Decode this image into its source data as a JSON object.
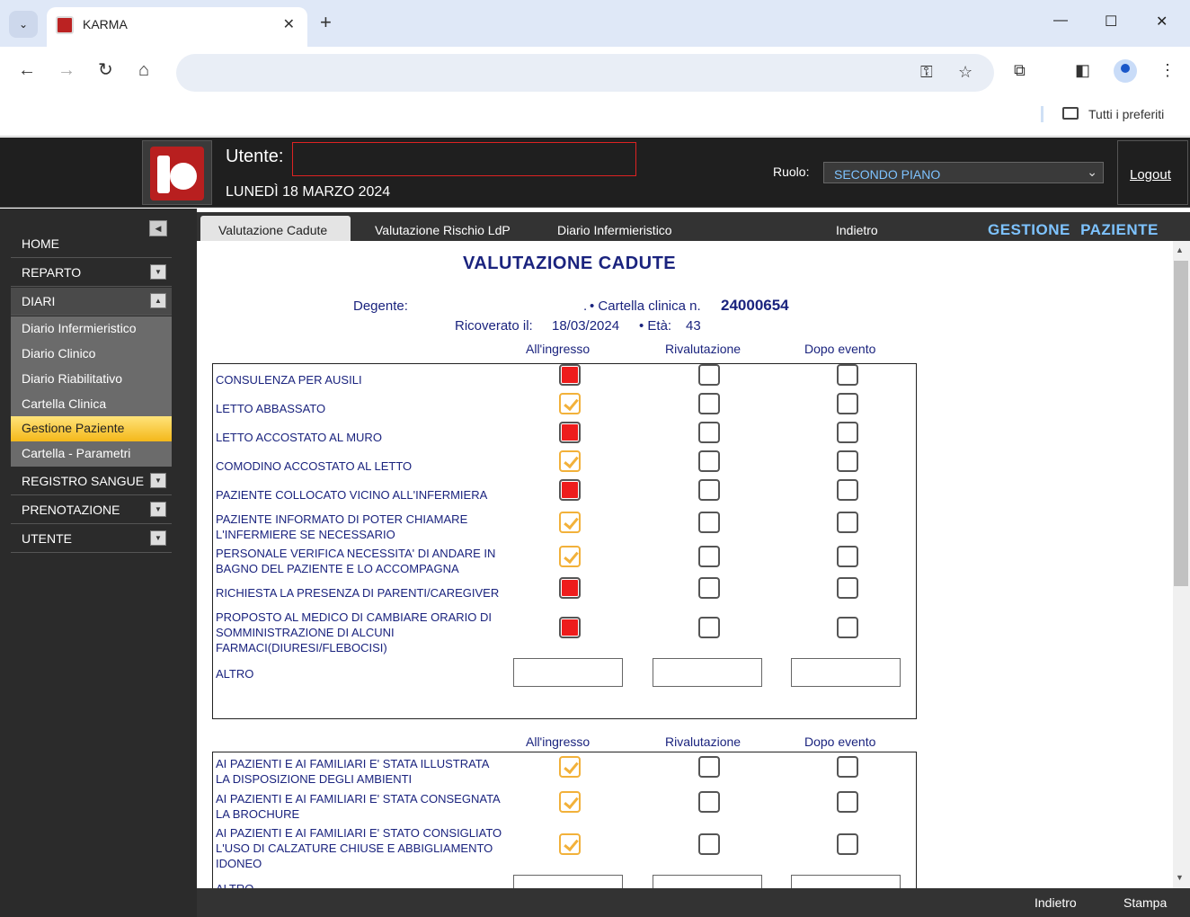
{
  "browser": {
    "tab_title": "KARMA",
    "bookmarks_label": "Tutti i preferiti"
  },
  "header": {
    "user_label": "Utente:",
    "user_value": "",
    "date": "LUNEDÌ 18 MARZO 2024",
    "role_label": "Ruolo:",
    "role_value": "SECONDO PIANO",
    "logout": "Logout"
  },
  "sidebar": {
    "items": [
      {
        "label": "HOME"
      },
      {
        "label": "REPARTO"
      },
      {
        "label": "DIARI"
      },
      {
        "label": "REGISTRO SANGUE"
      },
      {
        "label": "PRENOTAZIONE"
      },
      {
        "label": "UTENTE"
      }
    ],
    "sub_items": [
      {
        "label": "Diario Infermieristico"
      },
      {
        "label": "Diario Clinico"
      },
      {
        "label": "Diario Riabilitativo"
      },
      {
        "label": "Cartella Clinica"
      },
      {
        "label": "Gestione Paziente"
      },
      {
        "label": "Cartella - Parametri"
      }
    ]
  },
  "tabs": [
    {
      "label": "Valutazione Cadute"
    },
    {
      "label": "Valutazione Rischio LdP"
    },
    {
      "label": "Diario Infermieristico"
    },
    {
      "label": "Indietro"
    }
  ],
  "page_heading": "GESTIONE  PAZIENTE",
  "form": {
    "title": "VALUTAZIONE CADUTE",
    "degente_label": "Degente:",
    "degente_value": ".",
    "cartella_label": "• Cartella clinica n.",
    "cartella_value": "24000654",
    "ricoverato_label": "Ricoverato il:",
    "ricoverato_value": "18/03/2024",
    "eta_label": "• Età:",
    "eta_value": "43",
    "columns": [
      "All'ingresso",
      "Rivalutazione",
      "Dopo evento"
    ],
    "section1_rows": [
      {
        "label": "CONSULENZA PER AUSILI",
        "ingresso": "red",
        "rival": "empty",
        "dopo": "empty"
      },
      {
        "label": "LETTO ABBASSATO",
        "ingresso": "check",
        "rival": "empty",
        "dopo": "empty"
      },
      {
        "label": "LETTO ACCOSTATO AL MURO",
        "ingresso": "red",
        "rival": "empty",
        "dopo": "empty"
      },
      {
        "label": "COMODINO ACCOSTATO AL LETTO",
        "ingresso": "check",
        "rival": "empty",
        "dopo": "empty"
      },
      {
        "label": "PAZIENTE COLLOCATO VICINO ALL'INFERMIERA",
        "ingresso": "red",
        "rival": "empty",
        "dopo": "empty"
      },
      {
        "label": "PAZIENTE INFORMATO DI POTER CHIAMARE L'INFERMIERE SE NECESSARIO",
        "ingresso": "check",
        "rival": "empty",
        "dopo": "empty"
      },
      {
        "label": "PERSONALE VERIFICA NECESSITA' DI ANDARE IN BAGNO DEL PAZIENTE E LO ACCOMPAGNA",
        "ingresso": "check",
        "rival": "empty",
        "dopo": "empty"
      },
      {
        "label": "RICHIESTA LA PRESENZA DI PARENTI/CAREGIVER",
        "ingresso": "red",
        "rival": "empty",
        "dopo": "empty"
      },
      {
        "label": "PROPOSTO AL MEDICO DI CAMBIARE ORARIO DI SOMMINISTRAZIONE DI ALCUNI FARMACI(DIURESI/FLEBOCISI)",
        "ingresso": "red",
        "rival": "empty",
        "dopo": "empty"
      }
    ],
    "altro_label": "ALTRO",
    "section2_rows": [
      {
        "label": "AI PAZIENTI E AI FAMILIARI E' STATA ILLUSTRATA LA DISPOSIZIONE DEGLI AMBIENTI",
        "ingresso": "check",
        "rival": "empty",
        "dopo": "empty"
      },
      {
        "label": "AI PAZIENTI E AI FAMILIARI E' STATA CONSEGNATA LA BROCHURE",
        "ingresso": "check",
        "rival": "empty",
        "dopo": "empty"
      },
      {
        "label": "AI PAZIENTI E AI FAMILIARI E' STATO CONSIGLIATO L'USO DI CALZATURE CHIUSE E ABBIGLIAMENTO IDONEO",
        "ingresso": "check",
        "rival": "empty",
        "dopo": "empty"
      }
    ]
  },
  "footer": {
    "back": "Indietro",
    "print": "Stampa"
  }
}
